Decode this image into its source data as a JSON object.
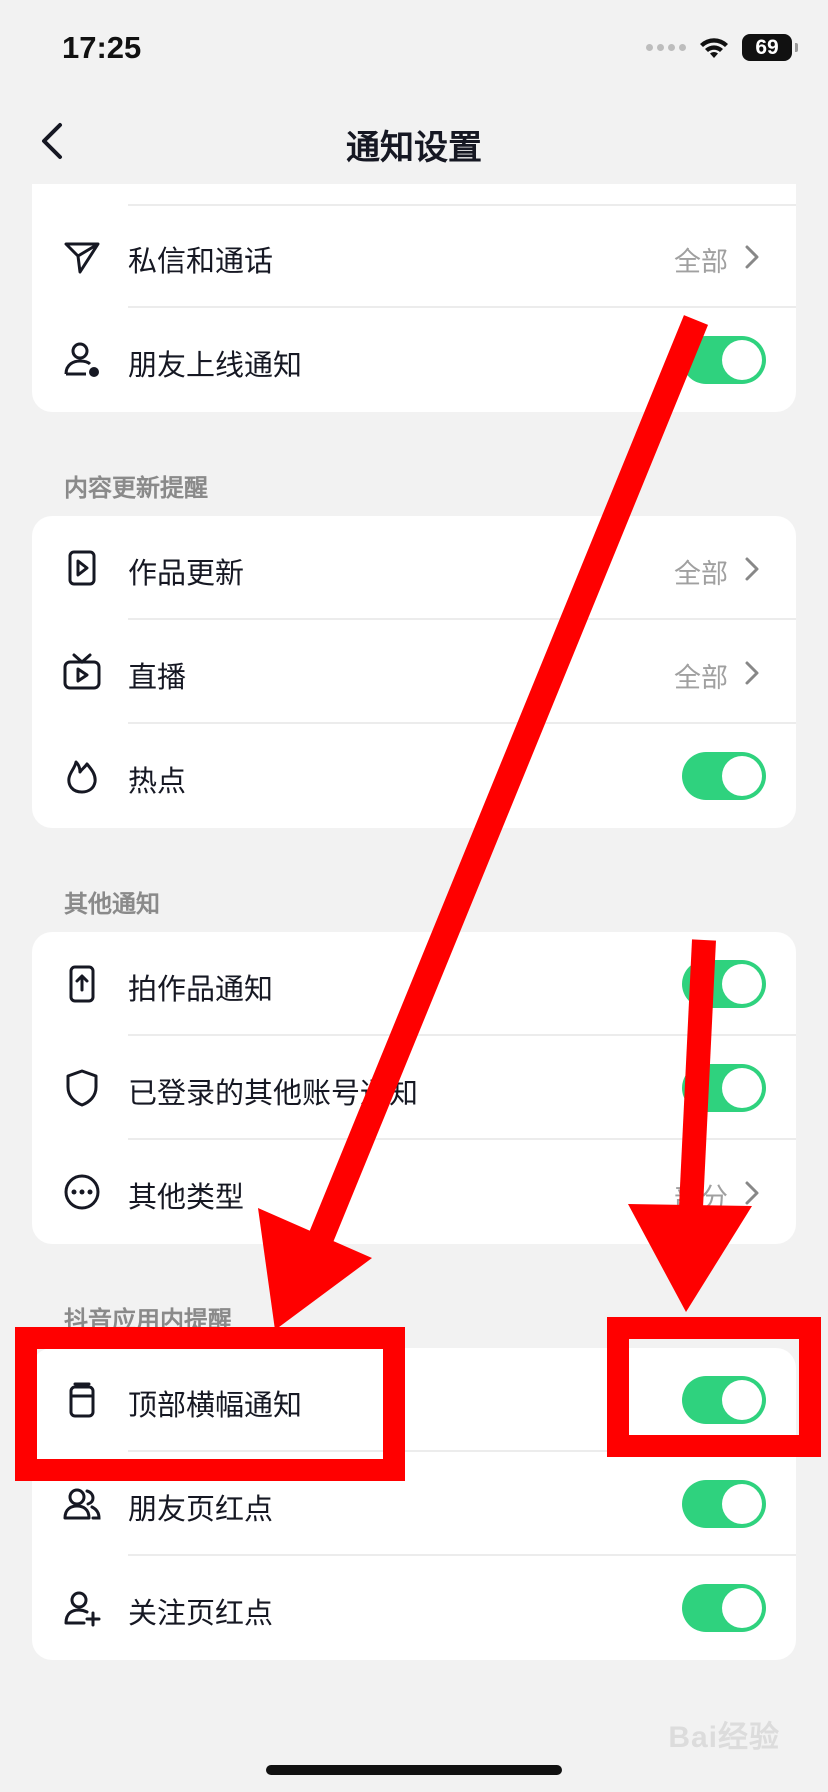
{
  "status_bar": {
    "time": "17:25",
    "battery": "69"
  },
  "nav": {
    "title": "通知设置"
  },
  "sections": [
    {
      "header": "",
      "rows": [
        {
          "label": "私信和通话",
          "value": "全部",
          "icon": "send-icon",
          "control": "chevron"
        },
        {
          "label": "朋友上线通知",
          "icon": "user-online-icon",
          "control": "toggle",
          "on": true
        }
      ]
    },
    {
      "header": "内容更新提醒",
      "rows": [
        {
          "label": "作品更新",
          "value": "全部",
          "icon": "video-update-icon",
          "control": "chevron"
        },
        {
          "label": "直播",
          "value": "全部",
          "icon": "tv-icon",
          "control": "chevron"
        },
        {
          "label": "热点",
          "icon": "flame-icon",
          "control": "toggle",
          "on": true
        }
      ]
    },
    {
      "header": "其他通知",
      "rows": [
        {
          "label": "拍作品通知",
          "icon": "phone-upload-icon",
          "control": "toggle",
          "on": true
        },
        {
          "label": "已登录的其他账号通知",
          "icon": "shield-icon",
          "control": "toggle",
          "on": true
        },
        {
          "label": "其他类型",
          "value": "部分",
          "icon": "more-icon",
          "control": "chevron"
        }
      ]
    },
    {
      "header": "抖音应用内提醒",
      "rows": [
        {
          "label": "顶部横幅通知",
          "icon": "banner-icon",
          "control": "toggle",
          "on": true
        },
        {
          "label": "朋友页红点",
          "icon": "friends-icon",
          "control": "toggle",
          "on": true
        },
        {
          "label": "关注页红点",
          "icon": "follow-add-icon",
          "control": "toggle",
          "on": true
        }
      ]
    }
  ],
  "colors": {
    "toggle_on": "#2fd27e",
    "annotation": "#ff0000",
    "background": "#f2f2f2"
  },
  "watermark": "Bai经验"
}
